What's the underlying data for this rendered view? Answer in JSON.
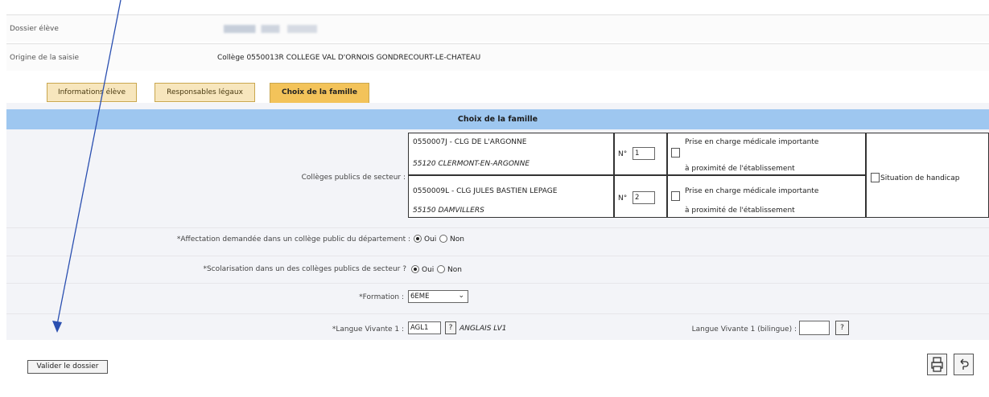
{
  "header": {
    "dossier_label": "Dossier élève",
    "origine_label": "Origine de la saisie",
    "origine_value": "Collège 0550013R COLLEGE VAL D'ORNOIS GONDRECOURT-LE-CHATEAU"
  },
  "tabs": [
    {
      "label": "Informations élève"
    },
    {
      "label": "Responsables légaux"
    },
    {
      "label": "Choix de la famille"
    }
  ],
  "section_title": "Choix de la famille",
  "colleges": {
    "label": "Collèges publics de secteur :",
    "items": [
      {
        "name": "0550007J - CLG DE L'ARGONNE",
        "city": "55120 CLERMONT-EN-ARGONNE",
        "num_label": "N°",
        "num_value": "1",
        "med_line1": "Prise en charge médicale importante",
        "med_line2": "à proximité de l'établissement"
      },
      {
        "name": "0550009L - CLG JULES BASTIEN LEPAGE",
        "city": "55150 DAMVILLERS",
        "num_label": "N°",
        "num_value": "2",
        "med_line1": "Prise en charge médicale importante",
        "med_line2": "à proximité de l'établissement"
      }
    ],
    "handicap_label": "Situation de handicap"
  },
  "affectation": {
    "label": "*Affectation demandée dans un collège public du département :",
    "oui": "Oui",
    "non": "Non"
  },
  "scolarisation": {
    "label": "*Scolarisation dans un des collèges publics de secteur ?",
    "oui": "Oui",
    "non": "Non"
  },
  "formation": {
    "label": "*Formation :",
    "value": "6EME"
  },
  "langue1": {
    "label": "*Langue Vivante 1 :",
    "code": "AGL1",
    "help": "?",
    "name": "ANGLAIS LV1"
  },
  "langue_bilingue": {
    "label": "Langue Vivante 1 (bilingue) :",
    "code": "",
    "help": "?"
  },
  "buttons": {
    "valider": "Valider le dossier"
  },
  "colors": {
    "bar": "#9ec7f0",
    "tab_inactive": "#f7e6bd",
    "tab_active": "#f3c35a",
    "arrow": "#2a4fb0"
  },
  "icons": [
    "print-icon",
    "return-icon",
    "annotation-arrow"
  ]
}
